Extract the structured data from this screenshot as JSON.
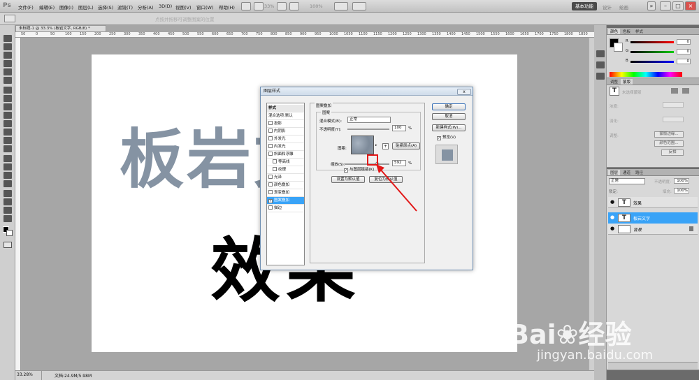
{
  "menubar": {
    "logo": "Ps",
    "items": [
      "文件(F)",
      "编辑(E)",
      "图像(I)",
      "图层(L)",
      "选择(S)",
      "滤镜(T)",
      "分析(A)",
      "3D(D)",
      "视图(V)",
      "窗口(W)",
      "帮助(H)"
    ],
    "zoom": "33%",
    "zoom_pct": "100%",
    "workspace_active": "基本功能",
    "workspace_items": [
      "设计",
      "绘画"
    ]
  },
  "options": {
    "hint": "点按并拖移可调整图案的位置"
  },
  "document": {
    "tab": "未标题-1 @ 33.3% (板岩文字, RGB/8) *",
    "ruler_labels": [
      "50",
      "0",
      "50",
      "100",
      "150",
      "200",
      "250",
      "300",
      "350",
      "400",
      "450",
      "500",
      "550",
      "600",
      "650",
      "700",
      "750",
      "800",
      "850",
      "900",
      "950",
      "1000",
      "1050",
      "1100",
      "1150",
      "1200",
      "1250",
      "1300",
      "1350",
      "1400",
      "1450",
      "1500",
      "1550",
      "1600",
      "1650",
      "1700",
      "1750",
      "1800",
      "1850"
    ],
    "text_top": "板岩文字",
    "text_bottom": "效果",
    "zoom": "33.28%",
    "size": "文档:24.9M/5.98M"
  },
  "color_panel": {
    "tabs": [
      "颜色",
      "色板",
      "样式"
    ],
    "channels": [
      {
        "label": "R",
        "value": "0"
      },
      {
        "label": "G",
        "value": "0"
      },
      {
        "label": "B",
        "value": "0"
      }
    ]
  },
  "adjust_panel": {
    "tabs": [
      "调整",
      "蒙版"
    ],
    "no_selection": "未选择蒙版",
    "rows": [
      "浓度:",
      "羽化:"
    ],
    "refine_label": "调整:",
    "buttons": [
      "蒙版边缘...",
      "颜色范围...",
      "反相"
    ]
  },
  "layers_panel": {
    "tabs": [
      "图层",
      "通道",
      "路径"
    ],
    "blend_mode": "正常",
    "opacity_label": "不透明度:",
    "opacity": "100%",
    "lock_label": "锁定:",
    "fill_label": "填充:",
    "fill": "100%",
    "layers": [
      {
        "name": "效果",
        "type": "T"
      },
      {
        "name": "板岩文字",
        "type": "T"
      },
      {
        "name": "背景",
        "type": ""
      }
    ]
  },
  "dialog": {
    "title": "图层样式",
    "styles_header": "样式",
    "blend_defaults": "混合选项:默认",
    "style_items": [
      {
        "label": "投影",
        "checked": false
      },
      {
        "label": "内阴影",
        "checked": false
      },
      {
        "label": "外发光",
        "checked": false
      },
      {
        "label": "内发光",
        "checked": false
      },
      {
        "label": "斜面和浮雕",
        "checked": false
      },
      {
        "label": "等高线",
        "checked": false
      },
      {
        "label": "纹理",
        "checked": false
      },
      {
        "label": "光泽",
        "checked": false
      },
      {
        "label": "颜色叠加",
        "checked": false
      },
      {
        "label": "渐变叠加",
        "checked": false
      },
      {
        "label": "图案叠加",
        "checked": true
      },
      {
        "label": "描边",
        "checked": false
      }
    ],
    "section_title": "图案叠加",
    "group_title": "图案",
    "blend_mode_label": "混合模式(B):",
    "blend_mode_value": "正常",
    "opacity_label": "不透明度(Y):",
    "opacity_value": "100",
    "opacity_unit": "%",
    "pattern_label": "图案:",
    "snap_button": "贴紧原点(A)",
    "scale_label": "缩放(S):",
    "scale_value": "592",
    "scale_unit": "%",
    "link_label": "与图层链接(K)",
    "link_checked": true,
    "set_default": "设置为默认值",
    "reset_default": "复位为默认值",
    "ok": "确定",
    "cancel": "取消",
    "new_style": "新建样式(W)...",
    "preview_label": "预览(V)",
    "preview_checked": true
  },
  "watermark": {
    "logo": "Bai",
    "logo2": "经验",
    "url": "jingyan.baidu.com"
  }
}
